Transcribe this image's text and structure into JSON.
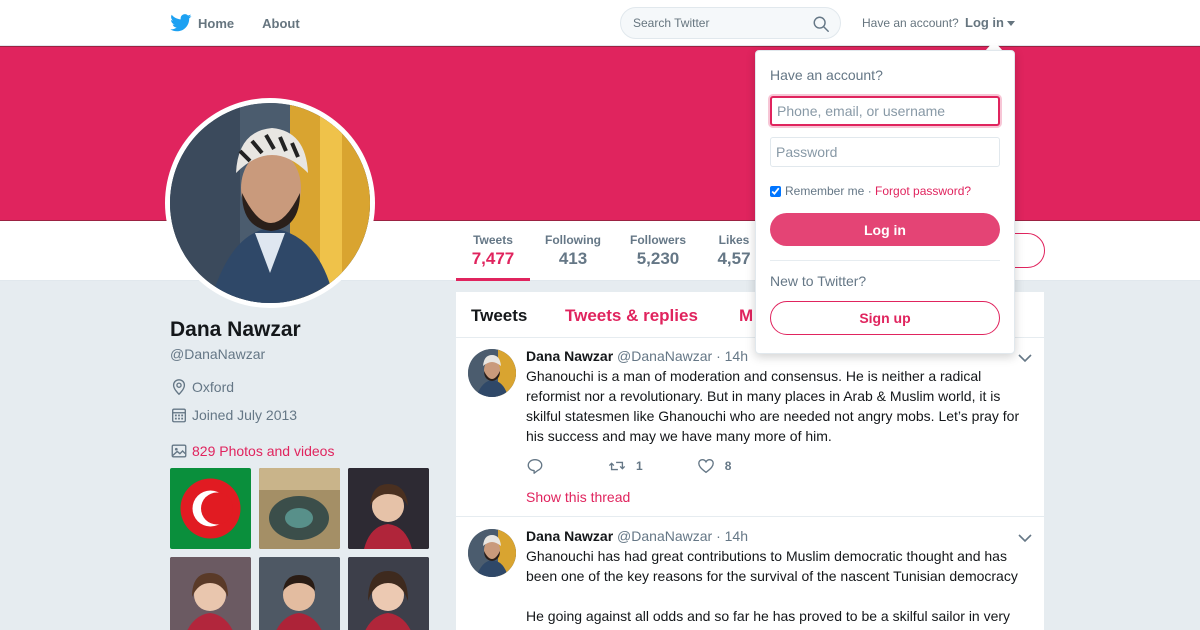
{
  "nav": {
    "home_label": "Home",
    "about_label": "About",
    "search_placeholder": "Search Twitter",
    "have_account": "Have an account?",
    "login_label": "Log in"
  },
  "colors": {
    "accent": "#e0245e",
    "banner": "#e0245e",
    "text_secondary": "#657786"
  },
  "profile": {
    "name": "Dana Nawzar",
    "handle": "@DanaNawzar",
    "location": "Oxford",
    "joined": "Joined July 2013",
    "photos_label": "829 Photos and videos"
  },
  "stats": [
    {
      "label": "Tweets",
      "value": "7,477"
    },
    {
      "label": "Following",
      "value": "413"
    },
    {
      "label": "Followers",
      "value": "5,230"
    },
    {
      "label": "Likes",
      "value": "4,57"
    }
  ],
  "tabs": [
    "Tweets",
    "Tweets & replies",
    "M"
  ],
  "tweets": [
    {
      "name": "Dana Nawzar",
      "handle": "@DanaNawzar",
      "time": "· 14h",
      "lines": [
        "Ghanouchi is a man of moderation and consensus. He is neither a radical",
        "reformist nor a revolutionary. But in many places in Arab & Muslim world, it is",
        "skilful statesmen like Ghanouchi who are needed not angry mobs. Let’s pray for",
        "his success and may we have many more of him."
      ],
      "retweets": "1",
      "likes": "8",
      "thread_link": "Show this thread"
    },
    {
      "name": "Dana Nawzar",
      "handle": "@DanaNawzar",
      "time": "· 14h",
      "lines": [
        "Ghanouchi has had great contributions to Muslim democratic thought and has",
        "been one of the key reasons for the survival of the nascent Tunisian democracy",
        "",
        "He going against all odds and so far he has proved to be a skilful sailor in very"
      ]
    }
  ],
  "login_dropdown": {
    "title": "Have an account?",
    "username_placeholder": "Phone, email, or username",
    "password_placeholder": "Password",
    "remember_label": "Remember me",
    "separator": " · ",
    "forgot_label": "Forgot password?",
    "login_button": "Log in",
    "new_label": "New to Twitter?",
    "signup_button": "Sign up"
  },
  "icons": {
    "logo": "twitter-bird-icon",
    "search": "search-icon",
    "location": "location-pin-icon",
    "calendar": "calendar-icon",
    "photos": "photo-icon",
    "reply": "reply-icon",
    "retweet": "retweet-icon",
    "like": "heart-icon",
    "chevron": "chevron-down-icon"
  }
}
